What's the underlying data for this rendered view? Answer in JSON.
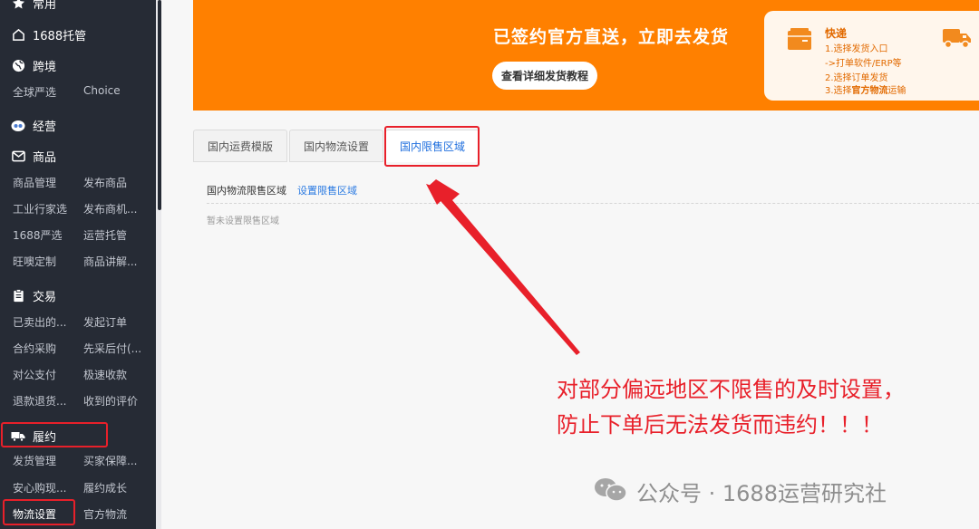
{
  "sidebar": {
    "sections": {
      "changyong": "常用",
      "tuoguan": "1688托管",
      "kuajing": "跨境",
      "jingying": "经营",
      "shangpin": "商品",
      "jiaoyi": "交易",
      "lvyue": "履约"
    },
    "items": {
      "quanqiu": "全球严选",
      "choice": "Choice",
      "spgl": "商品管理",
      "fbsp": "发布商品",
      "gyhx": "工业行家选",
      "fbsj": "发布商机...",
      "yx1688": "1688严选",
      "yytg": "运营托管",
      "wwdz": "旺噢定制",
      "spjj": "商品讲解...",
      "ymcd": "已卖出的...",
      "fqdd": "发起订单",
      "hycg": "合约采购",
      "xcbf": "先采后付(...",
      "dgzf": "对公支付",
      "jssk": "极速收款",
      "tkth": "退款退货...",
      "sdpj": "收到的评价",
      "fhgl": "发货管理",
      "mjbz": "买家保障...",
      "axgx": "安心购现...",
      "lycz": "履约成长",
      "wlsz": "物流设置",
      "gfwl": "官方物流"
    }
  },
  "banner": {
    "title": "已签约官方直送，立即去发货",
    "button": "查看详细发货教程",
    "card_title": "快递",
    "card_line1": "1.选择发货入口",
    "card_line2": "->打单软件/ERP等",
    "card_line3": "2.选择订单发货",
    "card_line4_a": "3.选择",
    "card_line4_b": "官方物流",
    "card_line4_c": "运输"
  },
  "tabs": {
    "tab1": "国内运费模版",
    "tab2": "国内物流设置",
    "tab3": "国内限售区域"
  },
  "content": {
    "label": "国内物流限售区域",
    "link": "设置限售区域",
    "empty": "暂未设置限售区域"
  },
  "annotation": {
    "line1": "对部分偏远地区不限售的及时设置，",
    "line2": "防止下单后无法发货而违约！！！"
  },
  "watermark": "公众号 · 1688运营研究社",
  "colors": {
    "sidebar_bg": "#262b35",
    "banner_orange": "#ff8000",
    "highlight_red": "#e8202a",
    "link_blue": "#2a7ae2"
  },
  "icons": {
    "changyong": "star-icon",
    "tuoguan": "home-icon",
    "kuajing": "globe-icon",
    "jingying": "eyes-icon",
    "shangpin": "mail-icon",
    "jiaoyi": "clipboard-icon",
    "lvyue": "truck-icon",
    "card_left": "package-icon",
    "card_right": "truck-icon"
  }
}
